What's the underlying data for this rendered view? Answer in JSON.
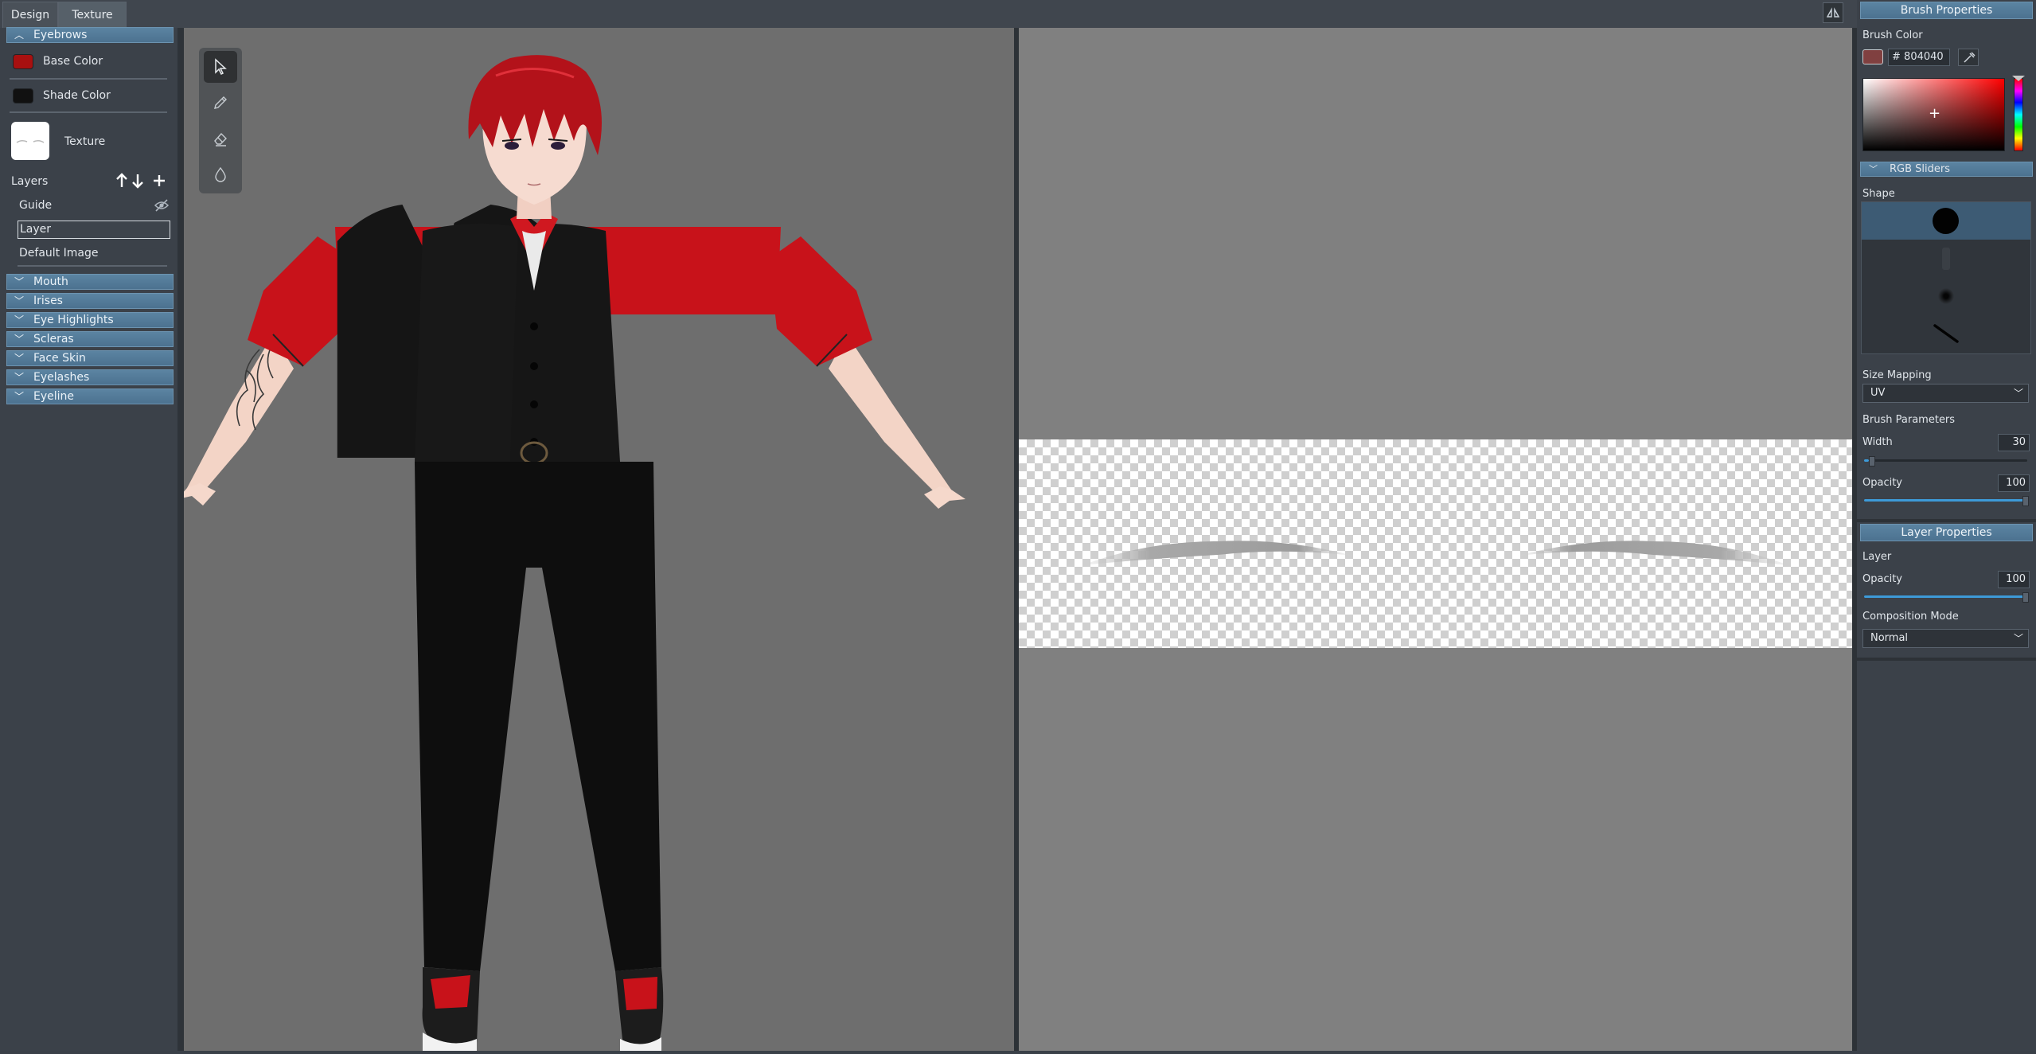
{
  "tabs": [
    "Design",
    "Texture"
  ],
  "left": {
    "expanded_section": "Eyebrows",
    "base_color_label": "Base Color",
    "shade_color_label": "Shade Color",
    "texture_label": "Texture",
    "layers_label": "Layers",
    "layers": [
      "Guide",
      "Layer",
      "Default Image"
    ],
    "collapsed_sections": [
      "Mouth",
      "Irises",
      "Eye Highlights",
      "Scleras",
      "Face Skin",
      "Eyelashes",
      "Eyeline"
    ]
  },
  "colors": {
    "base_color": "#a81010",
    "shade_color": "#111111",
    "brush_color": "#804040",
    "accent": "#4c7290",
    "hair": "#b3121a",
    "shirt": "#c8121a"
  },
  "brush": {
    "title": "Brush Properties",
    "color_label": "Brush Color",
    "hex_prefix": "#",
    "hex_value": "804040",
    "rgb_sliders_label": "RGB Sliders",
    "shape_label": "Shape",
    "size_mapping_label": "Size Mapping",
    "size_mapping_value": "UV",
    "params_label": "Brush Parameters",
    "width_label": "Width",
    "width_value": "30",
    "width_fraction": 0.03,
    "opacity_label": "Opacity",
    "opacity_value": "100",
    "opacity_fraction": 1.0
  },
  "layer_props": {
    "title": "Layer Properties",
    "layer_label": "Layer",
    "opacity_label": "Opacity",
    "opacity_value": "100",
    "opacity_fraction": 1.0,
    "composition_label": "Composition Mode",
    "composition_value": "Normal"
  },
  "icons": [
    "select-arrow-icon",
    "pencil-icon",
    "eraser-icon",
    "fill-drop-icon",
    "arrow-up-icon",
    "arrow-down-icon",
    "plus-icon",
    "eye-hidden-icon",
    "chevron-down-icon",
    "eyedropper-icon",
    "viewport-toggle-icon"
  ]
}
